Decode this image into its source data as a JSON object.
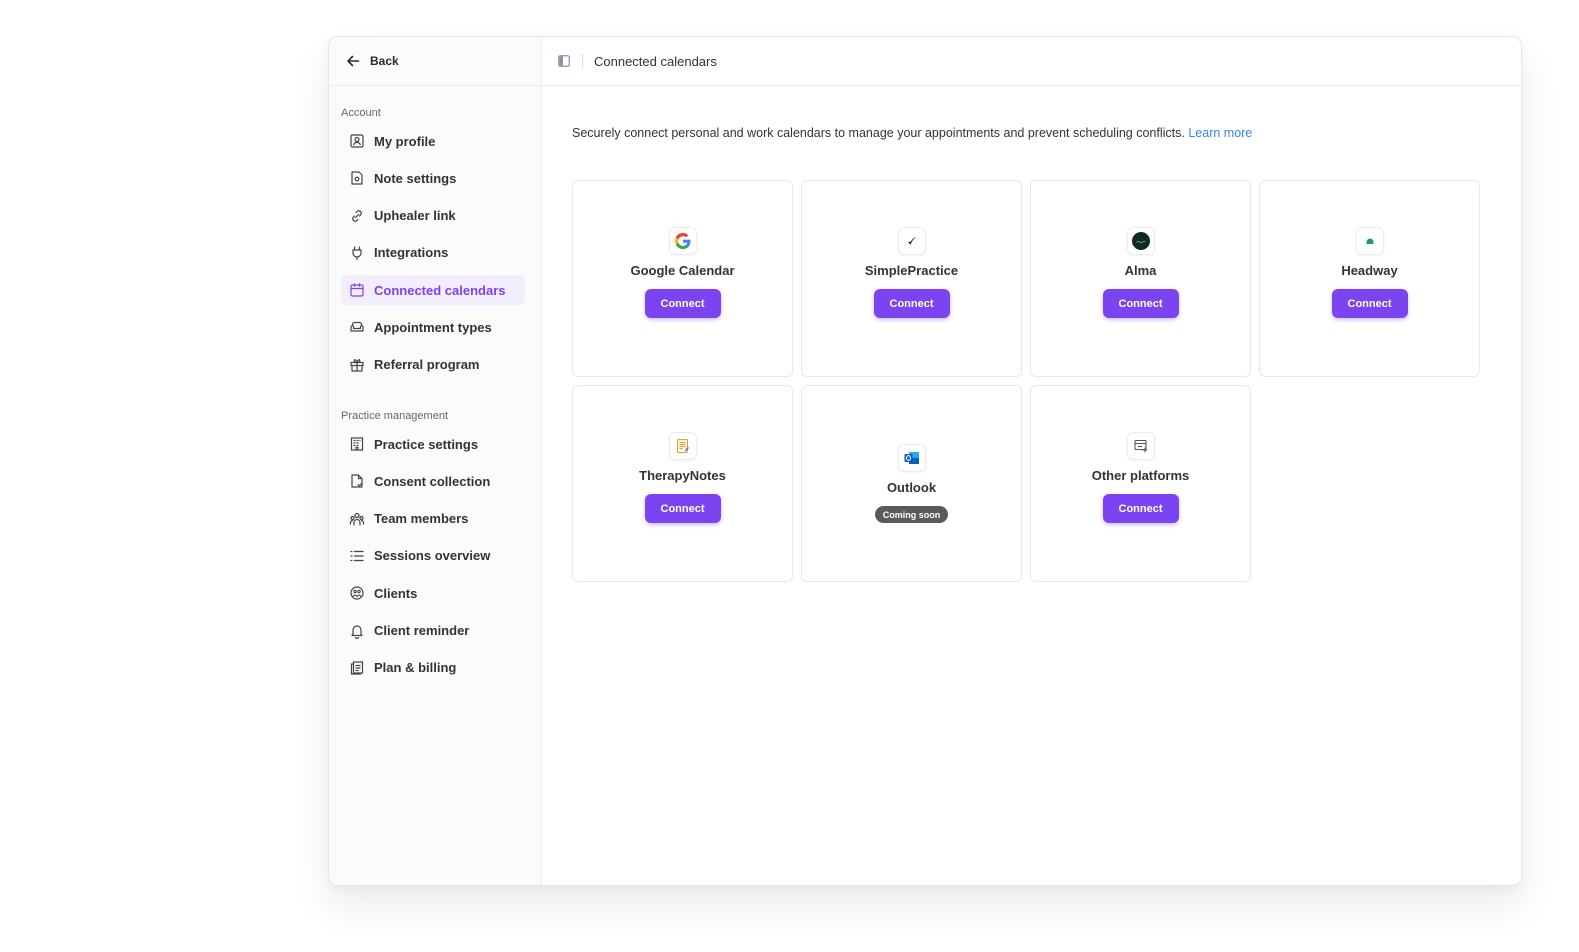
{
  "sidebar": {
    "back_label": "Back",
    "account_label": "Account",
    "account_items": [
      {
        "label": "My profile",
        "icon": "user-square-icon"
      },
      {
        "label": "Note settings",
        "icon": "note-gear-icon"
      },
      {
        "label": "Uphealer link",
        "icon": "link-icon"
      },
      {
        "label": "Integrations",
        "icon": "plug-icon"
      },
      {
        "label": "Connected calendars",
        "icon": "calendar-icon",
        "active": true
      },
      {
        "label": "Appointment types",
        "icon": "sofa-icon"
      },
      {
        "label": "Referral program",
        "icon": "gift-icon"
      }
    ],
    "practice_label": "Practice management",
    "practice_items": [
      {
        "label": "Practice settings",
        "icon": "building-icon"
      },
      {
        "label": "Consent collection",
        "icon": "document-sign-icon"
      },
      {
        "label": "Team members",
        "icon": "team-icon"
      },
      {
        "label": "Sessions overview",
        "icon": "list-icon"
      },
      {
        "label": "Clients",
        "icon": "clients-icon"
      },
      {
        "label": "Client reminder",
        "icon": "bell-icon"
      },
      {
        "label": "Plan & billing",
        "icon": "billing-icon"
      }
    ]
  },
  "header": {
    "title": "Connected calendars"
  },
  "main": {
    "description": "Securely connect personal and work calendars to manage your appointments and prevent scheduling conflicts.",
    "learn_more": "Learn more",
    "cards": [
      {
        "name": "Google Calendar",
        "action": "Connect",
        "icon": "google-icon"
      },
      {
        "name": "SimplePractice",
        "action": "Connect",
        "icon": "simplepractice-icon"
      },
      {
        "name": "Alma",
        "action": "Connect",
        "icon": "alma-icon"
      },
      {
        "name": "Headway",
        "action": "Connect",
        "icon": "headway-icon"
      },
      {
        "name": "TherapyNotes",
        "action": "Connect",
        "icon": "therapynotes-icon"
      },
      {
        "name": "Outlook",
        "badge": "Coming soon",
        "icon": "outlook-icon"
      },
      {
        "name": "Other platforms",
        "action": "Connect",
        "icon": "other-platforms-icon"
      }
    ]
  },
  "colors": {
    "accent": "#7c44f0",
    "active_bg": "#f2eefe",
    "link": "#3b82f6"
  }
}
